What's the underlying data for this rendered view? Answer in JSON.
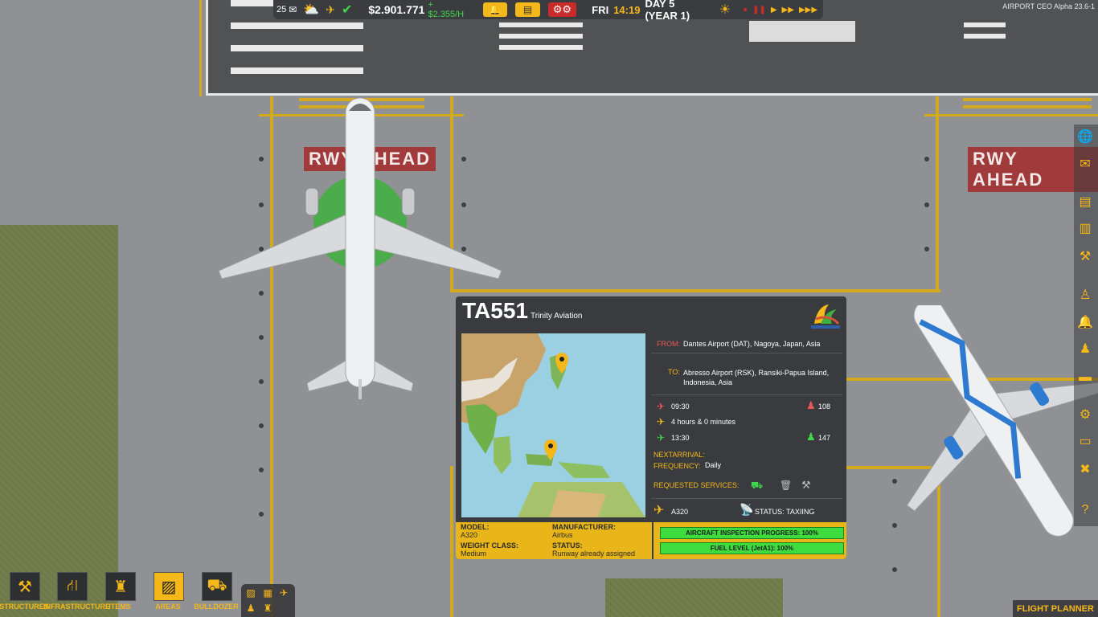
{
  "topbar": {
    "notifications_count": "25",
    "money": "$2.901.771",
    "rate": "+ $2.355/H",
    "day_name": "FRI",
    "clock": "14:19",
    "day_label": "DAY 5 (YEAR 1)"
  },
  "version": "AIRPORT CEO Alpha 23.6-1",
  "signs": {
    "left": "RWY AHEAD",
    "right": "RWY AHEAD"
  },
  "flight": {
    "number": "TA551",
    "airline": "Trinity Aviation",
    "from_label": "FROM:",
    "from_value": "Dantes Airport (DAT), Nagoya, Japan, Asia",
    "to_label": "TO:",
    "to_value": "Abresso Airport (RSK), Ransiki-Papua Island, Indonesia, Asia",
    "departure_time": "09:30",
    "departure_pax": "108",
    "duration": "4 hours & 0 minutes",
    "arrival_time": "13:30",
    "arrival_pax": "147",
    "next_arrival_label": "NEXTARRIVAL:",
    "next_arrival_value": "",
    "frequency_label": "FREQUENCY:",
    "frequency_value": "Daily",
    "requested_services_label": "REQUESTED SERVICES:",
    "aircraft_type": "A320",
    "status": "STATUS: TAXIING",
    "model_label": "MODEL:",
    "model_value": "A320",
    "manufacturer_label": "MANUFACTURER:",
    "manufacturer_value": "Airbus",
    "weight_label": "WEIGHT CLASS:",
    "weight_value": "Medium",
    "status_label": "STATUS:",
    "status_value": "Runway already assigned",
    "inspection_progress_label": "AIRCRAFT INSPECTION PROGRESS: 100%",
    "inspection_progress": 1.0,
    "fuel_label": "FUEL LEVEL (JetA1): 100%",
    "fuel_level": 1.0
  },
  "bottom_toolbar": {
    "structures": "STRUCTURES",
    "infrastructure": "INFRASTRUCTURE",
    "items": "ITEMS",
    "areas": "AREAS",
    "bulldozer": "BULLDOZER"
  },
  "flight_planner": "FLIGHT PLANNER",
  "colors": {
    "accent": "#f4b81a",
    "positive": "#3fd84d",
    "danger": "#c92a2a",
    "panel": "#3a3b3e"
  }
}
